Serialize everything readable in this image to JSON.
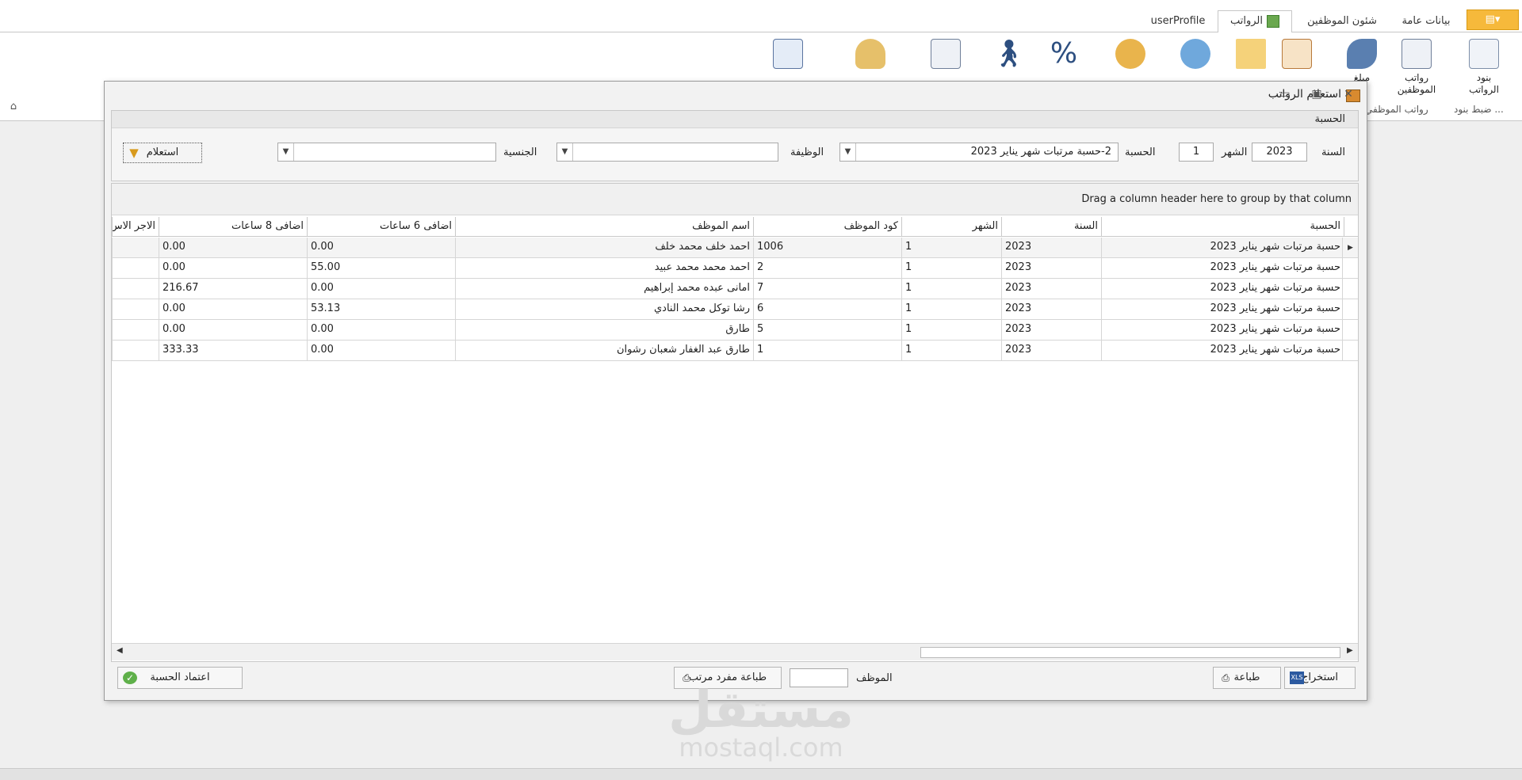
{
  "tabs": {
    "app_menu": "▤▾",
    "general": "بيانات عامة",
    "employees": "شئون الموظفين",
    "salaries": "الرواتب",
    "user_profile": "userProfile"
  },
  "ribbon": {
    "buttons": [
      {
        "label": "بنود الرواتب",
        "icon": "list-document-icon"
      },
      {
        "label": "رواتب الموظفين",
        "icon": "calculator-sheet-icon"
      },
      {
        "label": "مبلغ",
        "icon": "money-tag-icon"
      },
      {
        "label": "",
        "icon": "calendar-clock-icon"
      },
      {
        "label": "",
        "icon": "bed-person-icon"
      },
      {
        "label": "",
        "icon": "refresh-clock-icon"
      },
      {
        "label": "",
        "icon": "currency-coins-icon"
      },
      {
        "label": "",
        "icon": "percent-icon"
      },
      {
        "label": "",
        "icon": "walking-person-icon"
      },
      {
        "label": "",
        "icon": "calculator-icon"
      },
      {
        "label": "",
        "icon": "database-gear-icon"
      },
      {
        "label": "",
        "icon": "search-report-icon"
      }
    ],
    "group_labels": {
      "setup": "ضبط بنود ...",
      "employee_salaries": "رواتب الموظفي"
    }
  },
  "dialog": {
    "title": "استعلام الرواتب",
    "group_title": "الحسبة",
    "filters": {
      "year_label": "السنة",
      "year_value": "2023",
      "month_label": "الشهر",
      "month_value": "1",
      "calc_label": "الحسبة",
      "calc_value": "2-حسبة مرتبات شهر يناير 2023",
      "job_label": "الوظيفة",
      "job_value": "",
      "nationality_label": "الجنسية",
      "nationality_value": "",
      "query_button": "استعلام"
    },
    "grid": {
      "group_hint": "Drag a column header here to group by that column",
      "columns": [
        "الحسبة",
        "السنة",
        "الشهر",
        "كود الموظف",
        "اسم الموظف",
        "اضافى 6 ساعات",
        "اضافى 8 ساعات",
        "الاجر الاس"
      ],
      "rows": [
        {
          "calc": "حسبة مرتبات شهر يناير 2023",
          "year": "2023",
          "month": "1",
          "code": "1006",
          "name": "احمد خلف محمد خلف",
          "ot6": "0.00",
          "ot8": "0.00"
        },
        {
          "calc": "حسبة مرتبات شهر يناير 2023",
          "year": "2023",
          "month": "1",
          "code": "2",
          "name": "احمد محمد محمد عبيد",
          "ot6": "55.00",
          "ot8": "0.00"
        },
        {
          "calc": "حسبة مرتبات شهر يناير 2023",
          "year": "2023",
          "month": "1",
          "code": "7",
          "name": "امانى عبده محمد إبراهيم",
          "ot6": "0.00",
          "ot8": "216.67"
        },
        {
          "calc": "حسبة مرتبات شهر يناير 2023",
          "year": "2023",
          "month": "1",
          "code": "6",
          "name": "رشا توكل محمد النادي",
          "ot6": "53.13",
          "ot8": "0.00"
        },
        {
          "calc": "حسبة مرتبات شهر يناير 2023",
          "year": "2023",
          "month": "1",
          "code": "5",
          "name": "طارق",
          "ot6": "0.00",
          "ot8": "0.00"
        },
        {
          "calc": "حسبة مرتبات شهر يناير 2023",
          "year": "2023",
          "month": "1",
          "code": "1",
          "name": "طارق عبد الغفار شعبان رشوان",
          "ot6": "0.00",
          "ot8": "333.33"
        }
      ]
    },
    "footer": {
      "export": "استخراج",
      "print": "طباعة",
      "employee_label": "الموظف",
      "employee_value": "",
      "print_single": "طباعة مفرد مرتب",
      "approve": "اعتماد الحسبة"
    }
  },
  "watermark": {
    "arabic": "مستقل",
    "latin": "mostaql.com"
  }
}
